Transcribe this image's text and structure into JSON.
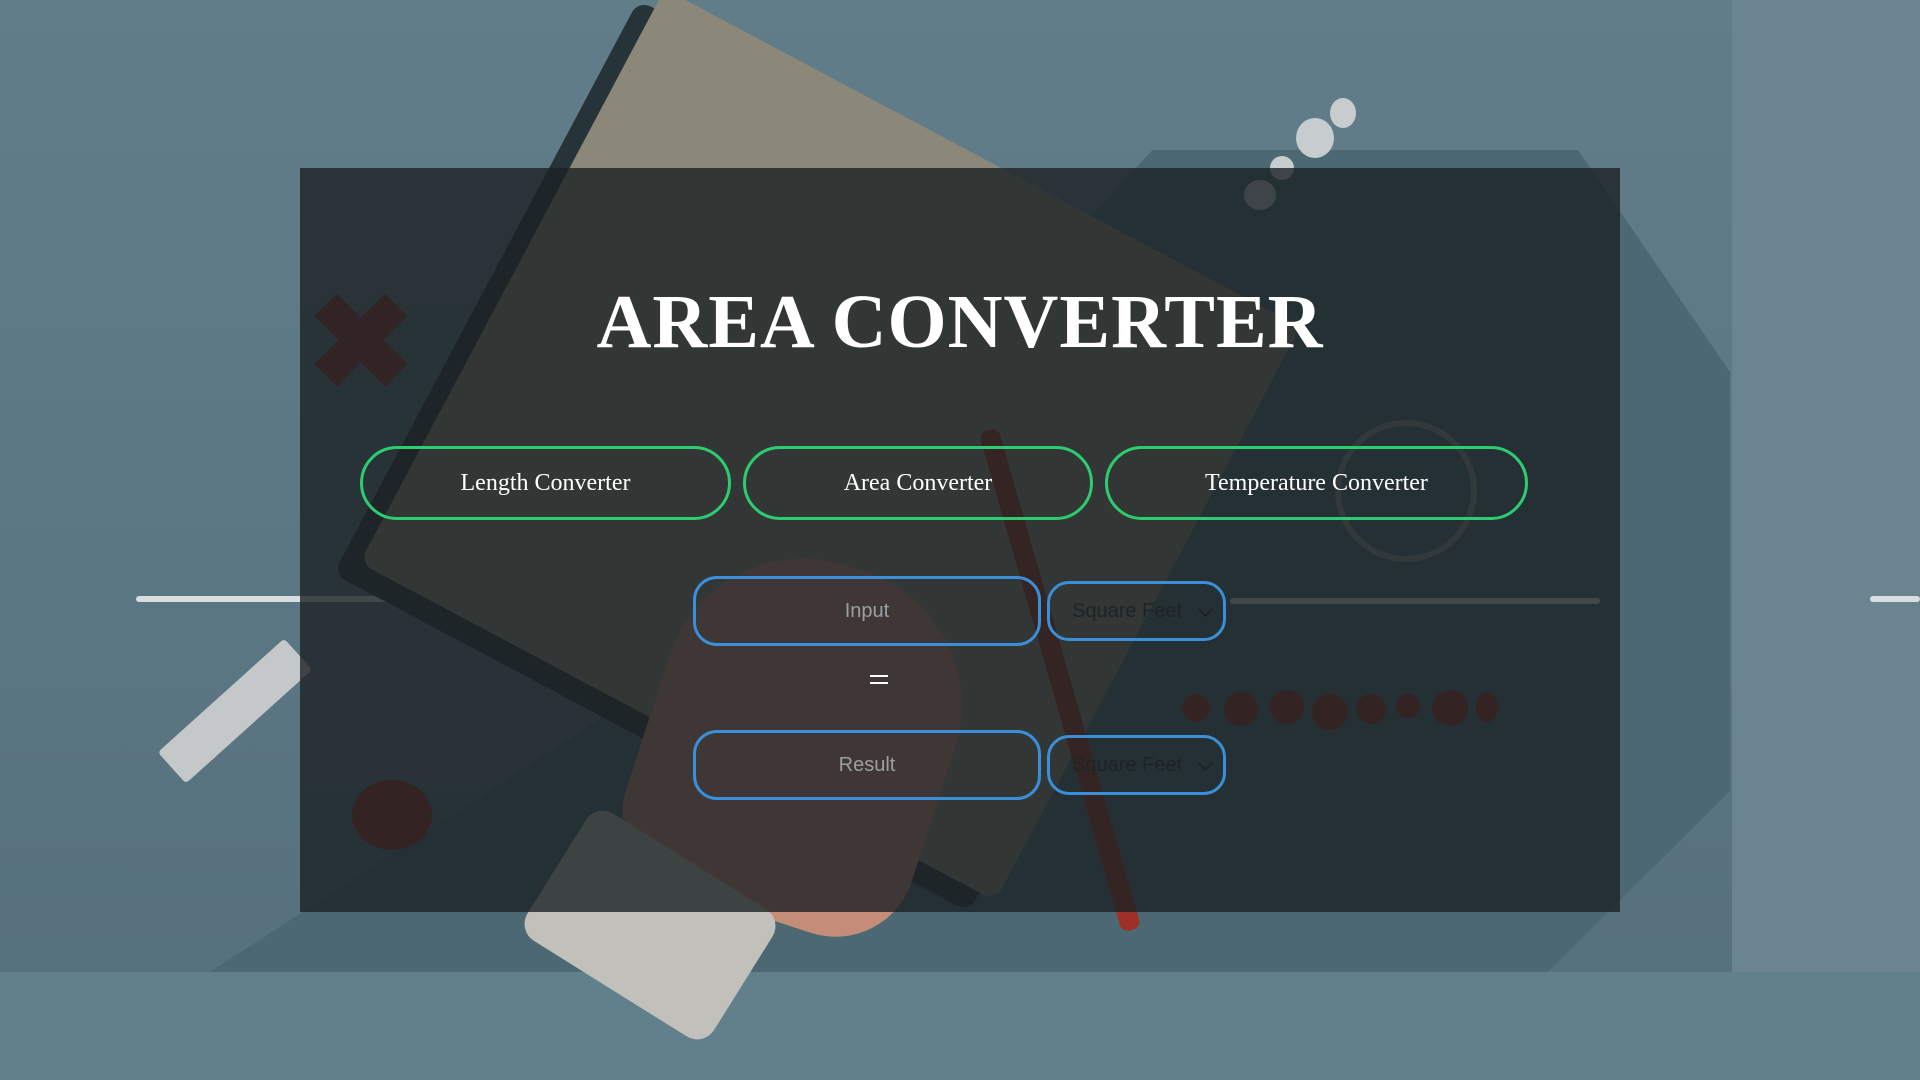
{
  "page": {
    "title": "AREA CONVERTER"
  },
  "nav": {
    "buttons": [
      {
        "label": "Length Converter"
      },
      {
        "label": "Area Converter"
      },
      {
        "label": "Temperature Converter"
      }
    ]
  },
  "converter": {
    "input": {
      "placeholder": "Input",
      "value": ""
    },
    "from_unit": {
      "selected": "Square Feet"
    },
    "equals_icon": "equals-icon",
    "result": {
      "placeholder": "Result",
      "value": ""
    },
    "to_unit": {
      "selected": "Square Feet"
    }
  },
  "colors": {
    "nav_border": "#2ecc71",
    "field_border": "#3a8fd8",
    "panel_overlay": "rgba(28,34,36,0.80)",
    "text": "#ffffff"
  }
}
